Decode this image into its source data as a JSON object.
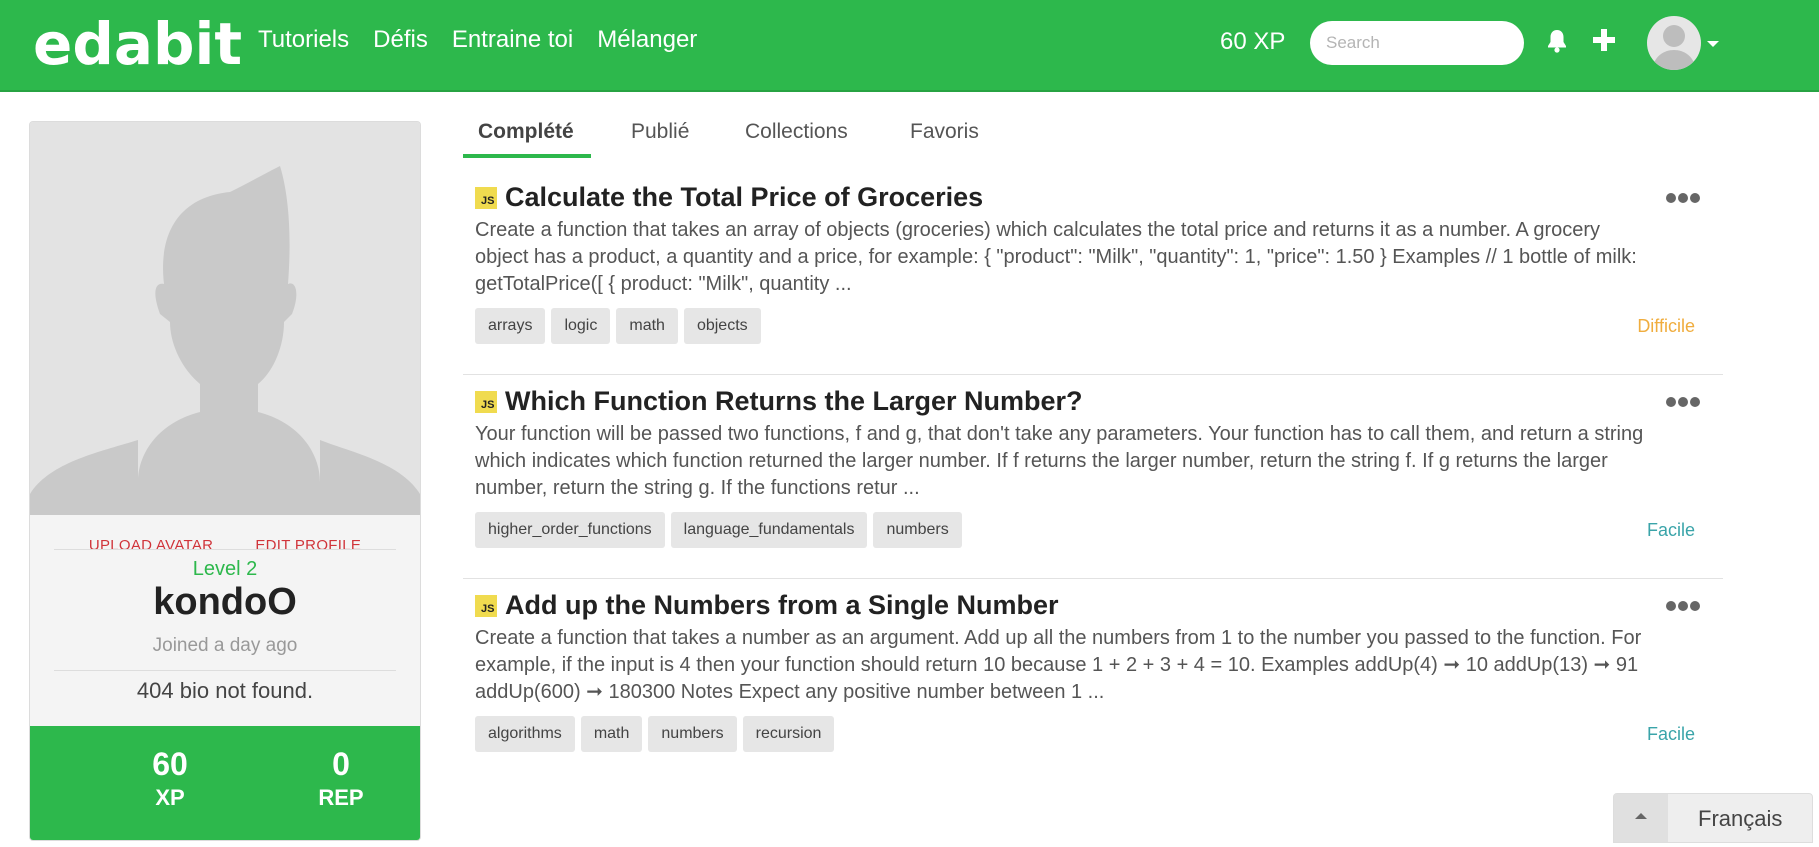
{
  "header": {
    "logo": "edabit",
    "nav": [
      "Tutoriels",
      "Défis",
      "Entraine toi",
      "Mélanger"
    ],
    "xp": "60 XP",
    "search_placeholder": "Search",
    "icons": [
      "bell-icon",
      "plus-icon",
      "avatar",
      "caret-down-icon"
    ]
  },
  "profile": {
    "upload_avatar": "UPLOAD AVATAR",
    "edit_profile": "EDIT PROFILE",
    "level": "Level 2",
    "username": "kondoO",
    "joined": "Joined a day ago",
    "bio": "404 bio not found.",
    "stats": [
      {
        "value": "60",
        "label": "XP"
      },
      {
        "value": "0",
        "label": "REP"
      }
    ]
  },
  "tabs": [
    "Complété",
    "Publié",
    "Collections",
    "Favoris"
  ],
  "challenges": [
    {
      "lang": "JS",
      "title": "Calculate the Total Price of Groceries",
      "description": "Create a function that takes an array of objects (groceries) which calculates the total price and returns it as a number. A grocery object has a product, a quantity and a price, for example: { \"product\": \"Milk\", \"quantity\": 1, \"price\": 1.50 } Examples // 1 bottle of milk: getTotalPrice([ { product: \"Milk\", quantity ...",
      "tags": [
        "arrays",
        "logic",
        "math",
        "objects"
      ],
      "difficulty": "Difficile"
    },
    {
      "lang": "JS",
      "title": "Which Function Returns the Larger Number?",
      "description": "Your function will be passed two functions, f and g, that don't take any parameters. Your function has to call them, and return a string which indicates which function returned the larger number. If f returns the larger number, return the string f. If g returns the larger number, return the string g. If the functions retur ...",
      "tags": [
        "higher_order_functions",
        "language_fundamentals",
        "numbers"
      ],
      "difficulty": "Facile"
    },
    {
      "lang": "JS",
      "title": "Add up the Numbers from a Single Number",
      "description": "Create a function that takes a number as an argument. Add up all the numbers from 1 to the number you passed to the function. For example, if the input is 4 then your function should return 10 because 1 + 2 + 3 + 4 = 10. Examples addUp(4) ➞ 10 addUp(13) ➞ 91 addUp(600) ➞ 180300 Notes Expect any positive number between 1 ...",
      "tags": [
        "algorithms",
        "math",
        "numbers",
        "recursion"
      ],
      "difficulty": "Facile"
    }
  ],
  "language_selector": "Français",
  "colors": {
    "brand": "#2db84c",
    "hard": "#f0ad3e",
    "easy": "#3aa4a9",
    "link_red": "#d0343a",
    "js_badge": "#f0db4f"
  }
}
